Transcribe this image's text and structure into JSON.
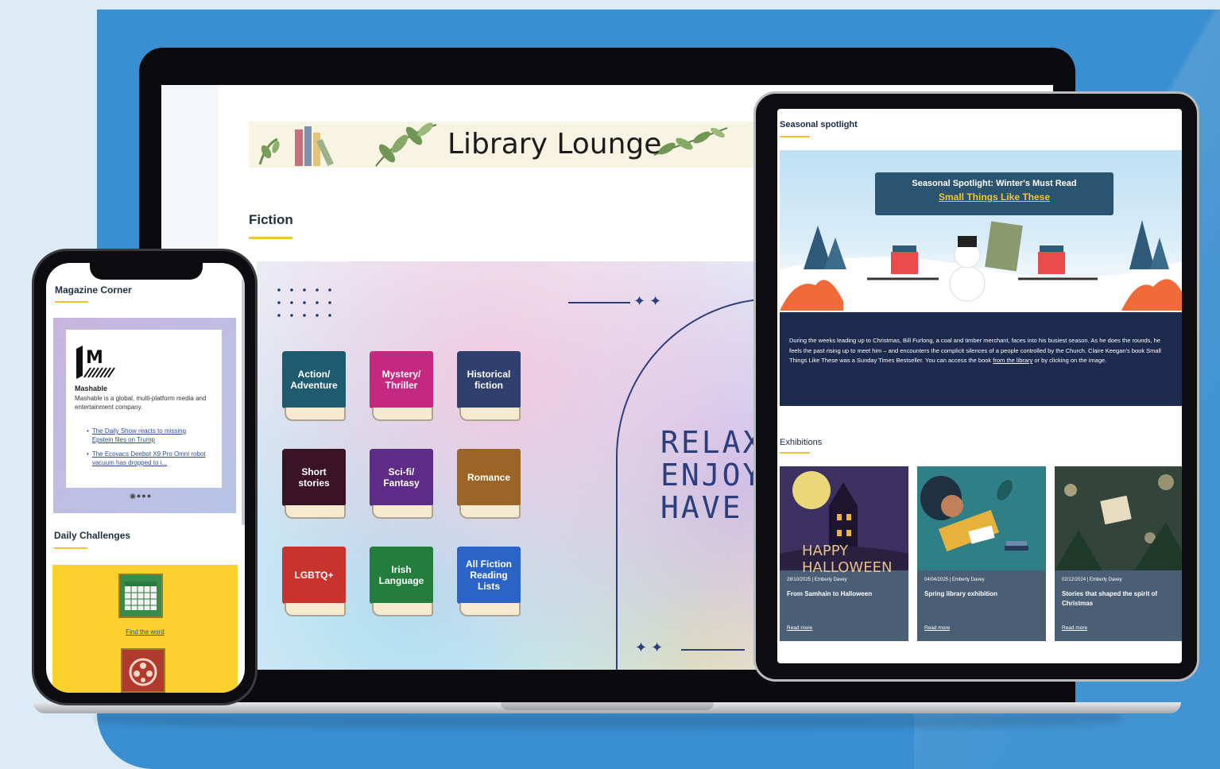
{
  "laptop": {
    "banner_title": "Library Lounge",
    "section_title": "Fiction",
    "books": [
      {
        "label": "Action/ Adventure",
        "color": "#1f5b6e"
      },
      {
        "label": "Mystery/ Thriller",
        "color": "#c4287f"
      },
      {
        "label": "Historical fiction",
        "color": "#2f3f6e"
      },
      {
        "label": "Short stories",
        "color": "#3a1424"
      },
      {
        "label": "Sci-fi/ Fantasy",
        "color": "#5c2c86"
      },
      {
        "label": "Romance",
        "color": "#9a6526"
      },
      {
        "label": "LGBTQ+",
        "color": "#c8332e"
      },
      {
        "label": "Irish Language",
        "color": "#237d3c"
      },
      {
        "label": "All Fiction Reading Lists",
        "color": "#2b64c6"
      }
    ],
    "relax_lines": [
      "RELAX",
      "ENJOY",
      "HAVE"
    ]
  },
  "phone": {
    "magazine_title": "Magazine Corner",
    "mag_name": "Mashable",
    "mag_desc": "Mashable is a global, multi-platform media and entertainment company.",
    "links": [
      "The Daily Show reacts to missing Epstein files on Trump",
      "The Ecovacs Deebot X9 Pro Omni robot vacuum has dropped to i..."
    ],
    "challenges_title": "Daily Challenges",
    "game1_label": "Find the word"
  },
  "tablet": {
    "spotlight_title": "Seasonal spotlight",
    "hero_line1": "Seasonal Spotlight: Winter's Must Read",
    "hero_line2": "Small Things Like These",
    "description": "During the weeks leading up to Christmas, Bill Furlong, a coal and timber merchant, faces into his busiest season. As he does the rounds, he feels the past rising up to meet him – and encounters the complicit silences of a people controlled by the Church. Claire Keegan's book Small Things Like These was a Sunday Times Bestseller. You can access the book",
    "desc_link": "from the library",
    "desc_tail": "or by clicking on the image.",
    "exhibitions_title": "Exhibitions",
    "exhibitions": [
      {
        "meta": "28/10/2025 | Emberly Davey",
        "title": "From Samhain to Halloween",
        "read": "Read more",
        "img_text": "HAPPY HALLOWEEN"
      },
      {
        "meta": "04/04/2025 | Emberly Davey",
        "title": "Spring library exhibition",
        "read": "Read more"
      },
      {
        "meta": "02/12/2024 | Emberly Davey",
        "title": "Stories that shaped the spirit of Christmas",
        "read": "Read more"
      }
    ]
  },
  "colors": {
    "accent": "#f2c230",
    "background_blue": "#3a8fd0",
    "navy": "#1c2a4e"
  }
}
